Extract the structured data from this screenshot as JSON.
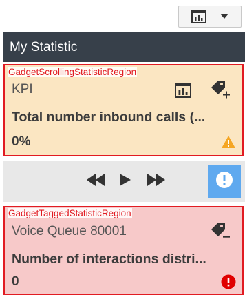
{
  "header": {
    "title": "My Statistic"
  },
  "regions": {
    "scrolling_label": "GadgetScrollingStatisticRegion",
    "tagged_label": "GadgetTaggedStatisticRegion"
  },
  "scrolling_statistic": {
    "category": "KPI",
    "name": "Total number inbound calls (...",
    "value": "0%",
    "status": "warning",
    "icons": [
      "chart-icon",
      "tag-add-icon",
      "warning-icon"
    ]
  },
  "player": {
    "icons": [
      "rewind-icon",
      "play-icon",
      "fast-forward-icon",
      "alert-icon"
    ]
  },
  "tagged_statistic": {
    "category": "Voice Queue 80001",
    "name": "Number of interactions distri...",
    "value": "0",
    "status": "error",
    "icons": [
      "tag-remove-icon",
      "error-icon"
    ]
  },
  "colors": {
    "header_bg": "#37404a",
    "scrolling_bg": "#fbe6c2",
    "tagged_bg": "#f7c9c9",
    "region_border": "#e11b22",
    "warning": "#f5a623",
    "error": "#e00000",
    "alert_button": "#5fa9ef"
  }
}
